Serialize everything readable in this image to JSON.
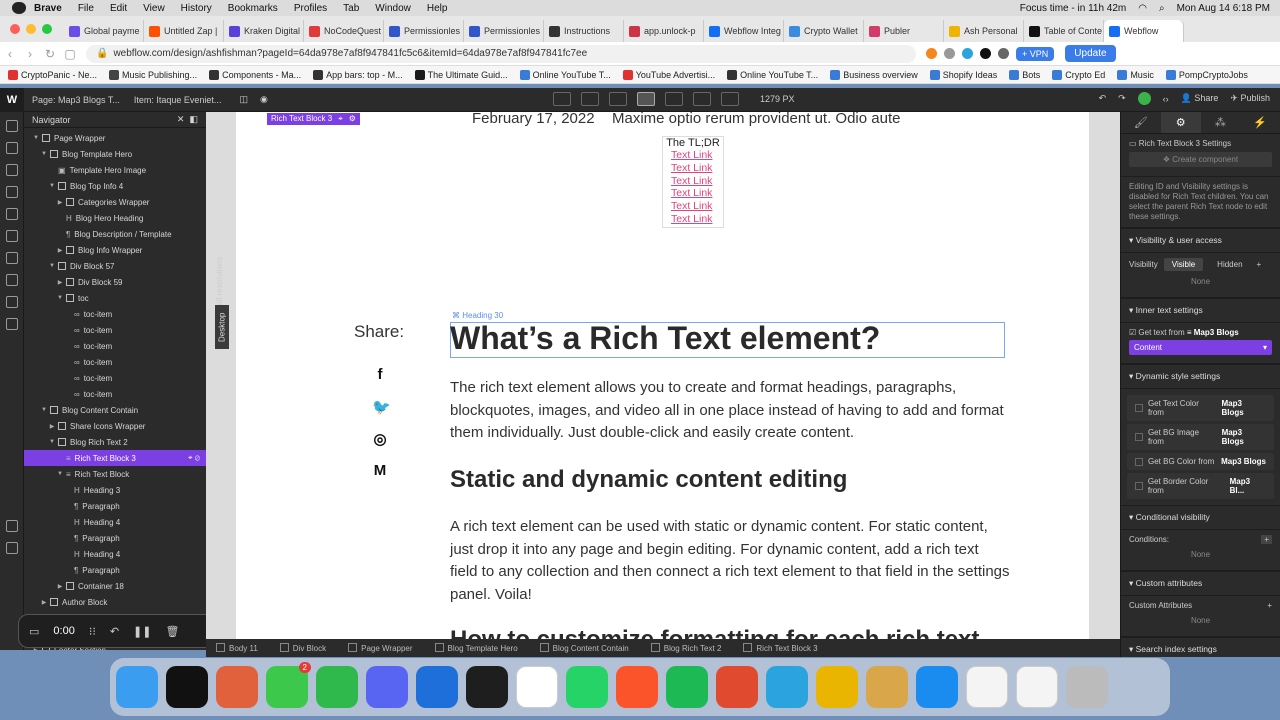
{
  "menubar": {
    "app": "Brave",
    "items": [
      "File",
      "Edit",
      "View",
      "History",
      "Bookmarks",
      "Profiles",
      "Tab",
      "Window",
      "Help"
    ],
    "focus": "Focus time - in 11h 42m",
    "datetime": "Mon Aug 14  6:18 PM"
  },
  "tabs": [
    {
      "label": "Global payme",
      "color": "#6b4ce8"
    },
    {
      "label": "Untitled Zap |",
      "color": "#ff4f00"
    },
    {
      "label": "Kraken Digital",
      "color": "#5741d9"
    },
    {
      "label": "NoCodeQuest",
      "color": "#e03a3a"
    },
    {
      "label": "Permissionles",
      "color": "#3355cc"
    },
    {
      "label": "Permissionles",
      "color": "#3355cc"
    },
    {
      "label": "Instructions",
      "color": "#333333"
    },
    {
      "label": "app.unlock-p",
      "color": "#cc3344"
    },
    {
      "label": "Webflow Integ",
      "color": "#146ef5"
    },
    {
      "label": "Crypto Wallet",
      "color": "#3a8dde"
    },
    {
      "label": "Publer",
      "color": "#d33b6a"
    },
    {
      "label": "Ash Personal",
      "color": "#f0b400"
    },
    {
      "label": "Table of Conte",
      "color": "#111111"
    },
    {
      "label": "Webflow",
      "color": "#146ef5",
      "active": true
    }
  ],
  "address": {
    "url": "webflow.com/design/ashfishman?pageId=64da978e7af8f947841fc5c6&itemId=64da978e7af8f947841fc7ee",
    "vpn": "VPN",
    "update": "Update"
  },
  "bookmarks": [
    {
      "label": "CryptoPanic - Ne...",
      "color": "#e03131"
    },
    {
      "label": "Music Publishing...",
      "color": "#444444"
    },
    {
      "label": "Components - Ma...",
      "color": "#333333"
    },
    {
      "label": "App bars: top - M...",
      "color": "#333333"
    },
    {
      "label": "The Ultimate Guid...",
      "color": "#1a1a1a"
    },
    {
      "label": "Online YouTube T...",
      "color": "#3a7bd5"
    },
    {
      "label": "YouTube Advertisi...",
      "color": "#e03131"
    },
    {
      "label": "Online YouTube T...",
      "color": "#333333"
    },
    {
      "label": "Business overview",
      "color": "#3a7bd5"
    },
    {
      "label": "Shopify Ideas",
      "color": "#3a7bd5"
    },
    {
      "label": "Bots",
      "color": "#3a7bd5"
    },
    {
      "label": "Crypto Ed",
      "color": "#3a7bd5"
    },
    {
      "label": "Music",
      "color": "#3a7bd5"
    },
    {
      "label": "PompCryptoJobs",
      "color": "#3a7bd5"
    }
  ],
  "designer": {
    "logo": "W",
    "page": "Page: Map3 Blogs T...",
    "item": "Item: Itaque Eveniet...",
    "width": "1279 PX",
    "share": "Share",
    "publish": "Publish"
  },
  "navigator": {
    "title": "Navigator",
    "rows": [
      {
        "label": "Page Wrapper",
        "indent": 0,
        "type": "box",
        "caret": "down"
      },
      {
        "label": "Blog Template Hero",
        "indent": 1,
        "type": "box",
        "caret": "down"
      },
      {
        "label": "Template Hero Image",
        "indent": 2,
        "type": "img",
        "caret": ""
      },
      {
        "label": "Blog Top Info 4",
        "indent": 2,
        "type": "box",
        "caret": "down"
      },
      {
        "label": "Categories Wrapper",
        "indent": 3,
        "type": "box",
        "caret": "right"
      },
      {
        "label": "Blog Hero Heading",
        "indent": 3,
        "type": "h",
        "caret": ""
      },
      {
        "label": "Blog Description / Template",
        "indent": 3,
        "type": "p",
        "caret": ""
      },
      {
        "label": "Blog Info Wrapper",
        "indent": 3,
        "type": "box",
        "caret": "right"
      },
      {
        "label": "Div Block 57",
        "indent": 2,
        "type": "box",
        "caret": "down"
      },
      {
        "label": "Div Block 59",
        "indent": 3,
        "type": "box",
        "caret": "right"
      },
      {
        "label": "toc",
        "indent": 3,
        "type": "box",
        "caret": "down"
      },
      {
        "label": "toc-item",
        "indent": 4,
        "type": "link",
        "caret": ""
      },
      {
        "label": "toc-item",
        "indent": 4,
        "type": "link",
        "caret": ""
      },
      {
        "label": "toc-item",
        "indent": 4,
        "type": "link",
        "caret": ""
      },
      {
        "label": "toc-item",
        "indent": 4,
        "type": "link",
        "caret": ""
      },
      {
        "label": "toc-item",
        "indent": 4,
        "type": "link",
        "caret": ""
      },
      {
        "label": "toc-item",
        "indent": 4,
        "type": "link",
        "caret": ""
      },
      {
        "label": "Blog Content Contain",
        "indent": 1,
        "type": "box",
        "caret": "down"
      },
      {
        "label": "Share Icons Wrapper",
        "indent": 2,
        "type": "box",
        "caret": "right"
      },
      {
        "label": "Blog Rich Text 2",
        "indent": 2,
        "type": "box",
        "caret": "down"
      },
      {
        "label": "Rich Text Block 3",
        "indent": 3,
        "type": "rt",
        "caret": "",
        "selected": true
      },
      {
        "label": "Rich Text Block",
        "indent": 3,
        "type": "rt",
        "caret": "down"
      },
      {
        "label": "Heading 3",
        "indent": 4,
        "type": "h",
        "caret": ""
      },
      {
        "label": "Paragraph",
        "indent": 4,
        "type": "p",
        "caret": ""
      },
      {
        "label": "Heading 4",
        "indent": 4,
        "type": "h",
        "caret": ""
      },
      {
        "label": "Paragraph",
        "indent": 4,
        "type": "p",
        "caret": ""
      },
      {
        "label": "Heading 4",
        "indent": 4,
        "type": "h",
        "caret": ""
      },
      {
        "label": "Paragraph",
        "indent": 4,
        "type": "p",
        "caret": ""
      },
      {
        "label": "Container 18",
        "indent": 3,
        "type": "box",
        "caret": "right"
      },
      {
        "label": "Author Block",
        "indent": 1,
        "type": "box",
        "caret": "right"
      },
      {
        "label": "",
        "indent": 1,
        "type": "box",
        "caret": "right"
      },
      {
        "label": "",
        "indent": 1,
        "type": "box",
        "caret": "right"
      },
      {
        "label": "Footer Section",
        "indent": 0,
        "type": "box",
        "caret": "right"
      }
    ]
  },
  "recorder": {
    "time": "0:00"
  },
  "canvas": {
    "vertical_note": "Affects all resolutions",
    "device": "Desktop",
    "selected_label": "Rich Text Block 3",
    "date": "February 17, 2022",
    "date_text": "Maxime optio rerum provident ut. Odio aute",
    "tldr_title": "The TL;DR",
    "tldr_links": [
      "Text Link",
      "Text Link",
      "Text Link",
      "Text Link",
      "Text Link",
      "Text Link"
    ],
    "share": "Share:",
    "social": [
      {
        "name": "facebook-icon",
        "glyph": "f"
      },
      {
        "name": "twitter-icon",
        "glyph": "🐦"
      },
      {
        "name": "instagram-icon",
        "glyph": "◎"
      },
      {
        "name": "medium-icon",
        "glyph": "M"
      }
    ],
    "heading_tag": "Heading 30",
    "h2": "What’s a Rich Text element?",
    "p1": "The rich text element allows you to create and format headings, paragraphs, blockquotes, images, and video all in one place instead of having to add and format them individually. Just double-click and easily create content.",
    "h3": "Static and dynamic content editing",
    "p2": "A rich text element can be used with static or dynamic content. For static content, just drop it into any page and begin editing. For dynamic content, add a rich text field to any collection and then connect a rich text element to that field in the settings panel. Voila!",
    "h3b": "How to customize formatting for each rich text"
  },
  "breadcrumbs": [
    "Body 11",
    "Div Block",
    "Page Wrapper",
    "Blog Template Hero",
    "Blog Content Contain",
    "Blog Rich Text 2",
    "Rich Text Block 3"
  ],
  "panel": {
    "title": "Rich Text Block 3 Settings",
    "create_component": "Create component",
    "note": "Editing ID and Visibility settings is disabled for Rich Text children. You can select the parent Rich Text node to edit these settings.",
    "visibility_head": "Visibility & user access",
    "visibility_label": "Visibility",
    "visible": "Visible",
    "hidden": "Hidden",
    "none": "None",
    "inner_head": "Inner text settings",
    "get_text": "Get text from",
    "source": "Map3 Blogs",
    "content": "Content",
    "dyn_head": "Dynamic style settings",
    "dyn": [
      {
        "label": "Get Text Color from",
        "src": "Map3 Blogs"
      },
      {
        "label": "Get BG Image from",
        "src": "Map3 Blogs"
      },
      {
        "label": "Get BG Color from",
        "src": "Map3 Blogs"
      },
      {
        "label": "Get Border Color from",
        "src": "Map3 Bl..."
      }
    ],
    "cond_head": "Conditional visibility",
    "conditions": "Conditions:",
    "attr_head": "Custom attributes",
    "attr_label": "Custom Attributes",
    "search_head": "Search index settings"
  },
  "dock": [
    {
      "name": "finder-icon",
      "color": "#3a9df0"
    },
    {
      "name": "apple-tv-icon",
      "color": "#111111"
    },
    {
      "name": "launchpad-icon",
      "color": "#e0613b"
    },
    {
      "name": "messages-icon",
      "color": "#3cc84a",
      "badge": "2"
    },
    {
      "name": "facetime-icon",
      "color": "#2fb84b"
    },
    {
      "name": "discord-icon",
      "color": "#5865f2"
    },
    {
      "name": "xcode-icon",
      "color": "#1e6fd9"
    },
    {
      "name": "figma-icon",
      "color": "#1e1e1e"
    },
    {
      "name": "slack-icon",
      "color": "#ffffff"
    },
    {
      "name": "whatsapp-icon",
      "color": "#25d366"
    },
    {
      "name": "brave-icon",
      "color": "#fb542b"
    },
    {
      "name": "spotify-icon",
      "color": "#1db954"
    },
    {
      "name": "fantastical-icon",
      "color": "#e04a2f"
    },
    {
      "name": "telegram-icon",
      "color": "#2aa3df"
    },
    {
      "name": "chrome-icon",
      "color": "#e9b500"
    },
    {
      "name": "storage-app-icon",
      "color": "#d9a64a"
    },
    {
      "name": "app-store-icon",
      "color": "#1a8cf0"
    },
    {
      "name": "preview-icon",
      "color": "#f4f4f4"
    },
    {
      "name": "preview-icon-2",
      "color": "#f4f4f4"
    },
    {
      "name": "trash-icon",
      "color": "#bbbbbb"
    }
  ]
}
